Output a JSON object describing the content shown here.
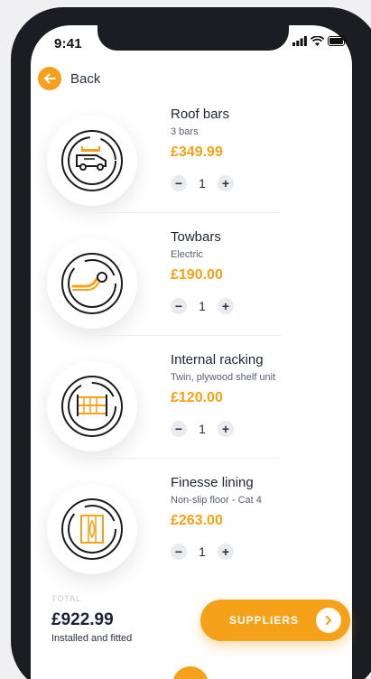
{
  "status_bar": {
    "time": "9:41",
    "icons": [
      "signal-icon",
      "wifi-icon",
      "battery-icon"
    ]
  },
  "nav": {
    "back_label": "Back"
  },
  "items": [
    {
      "name": "Roof bars",
      "subtitle": "3 bars",
      "price": "£349.99",
      "quantity": "1",
      "icon": "van-roof-bars-icon"
    },
    {
      "name": "Towbars",
      "subtitle": "Electric",
      "price": "£190.00",
      "quantity": "1",
      "icon": "towbar-icon"
    },
    {
      "name": "Internal racking",
      "subtitle": "Twin, plywood shelf unit",
      "price": "£120.00",
      "quantity": "1",
      "icon": "racking-icon"
    },
    {
      "name": "Finesse lining",
      "subtitle": "Non-slip floor - Cat 4",
      "price": "£263.00",
      "quantity": "1",
      "icon": "lining-icon"
    }
  ],
  "qty_controls": {
    "minus": "−",
    "plus": "+"
  },
  "footer": {
    "total_label": "TOTAL",
    "total_value": "£922.99",
    "total_note": "Installed and fitted",
    "suppliers_label": "SUPPLIERS"
  },
  "colors": {
    "accent": "#f5a11a",
    "text_dark": "#1b2238",
    "phone_frame": "#1c1d22"
  }
}
